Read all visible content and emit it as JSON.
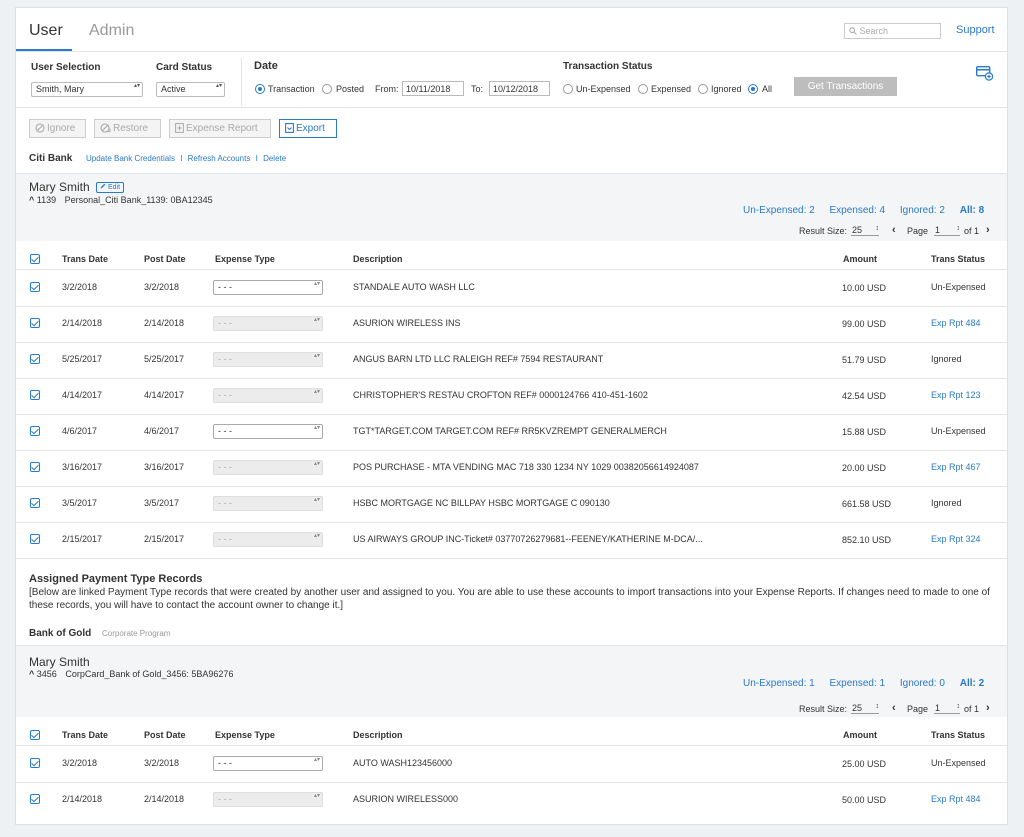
{
  "tabs": {
    "user": "User",
    "admin": "Admin"
  },
  "header": {
    "search_placeholder": "Search",
    "support": "Support"
  },
  "filters": {
    "user_selection_label": "User Selection",
    "user_selection_value": "Smith, Mary",
    "card_status_label": "Card Status",
    "card_status_value": "Active",
    "date_label": "Date",
    "date_options": [
      "Transaction",
      "Posted"
    ],
    "from_label": "From:",
    "from_value": "10/11/2018",
    "to_label": "To:",
    "to_value": "10/12/2018",
    "trans_status_label": "Transaction Status",
    "status_options": [
      "Un-Expensed",
      "Expensed",
      "Ignored",
      "All"
    ],
    "get_button": "Get Transactions"
  },
  "toolbar": {
    "ignore": "Ignore",
    "restore": "Restore",
    "expense_report": "Expense Report",
    "export": "Export"
  },
  "bank1": {
    "name": "Citi Bank",
    "links": [
      "Update Bank Credentials",
      "Refresh Accounts",
      "Delete"
    ],
    "sep": "I"
  },
  "account1": {
    "name": "Mary Smith",
    "edit": "Edit",
    "number": "1139",
    "detail": "Personal_Citi Bank_1139: 0BA12345",
    "counts": {
      "unexpensed": "Un-Expensed: 2",
      "expensed": "Expensed: 4",
      "ignored": "Ignored: 2",
      "all": "All: 8"
    },
    "result_size_label": "Result Size:",
    "result_size": "25",
    "page_label": "Page",
    "page": "1",
    "of": "of 1"
  },
  "columns": {
    "trans_date": "Trans Date",
    "post_date": "Post Date",
    "expense_type": "Expense Type",
    "description": "Description",
    "amount": "Amount",
    "trans_status": "Trans Status"
  },
  "rows1": [
    {
      "trans": "3/2/2018",
      "post": "3/2/2018",
      "etype": "- - -",
      "desc": "STANDALE AUTO WASH LLC",
      "amount": "10.00 USD",
      "status": "Un-Expensed"
    },
    {
      "trans": "2/14/2018",
      "post": "2/14/2018",
      "etype": "- - -",
      "desc": "ASURION WIRELESS INS",
      "amount": "99.00 USD",
      "status": "Exp Rpt 484"
    },
    {
      "trans": "5/25/2017",
      "post": "5/25/2017",
      "etype": "- - -",
      "desc": "ANGUS BARN LTD LLC RALEIGH REF# 7594 RESTAURANT",
      "amount": "51.79 USD",
      "status": "Ignored"
    },
    {
      "trans": "4/14/2017",
      "post": "4/14/2017",
      "etype": "- - -",
      "desc": "CHRISTOPHER'S RESTAU CROFTON REF# 0000124766 410-451-1602",
      "amount": "42.54 USD",
      "status": "Exp Rpt 123"
    },
    {
      "trans": "4/6/2017",
      "post": "4/6/2017",
      "etype": "- - -",
      "desc": "TGT*TARGET.COM TARGET.COM REF# RR5KVZREMPT GENERALMERCH",
      "amount": "15.88 USD",
      "status": "Un-Expensed"
    },
    {
      "trans": "3/16/2017",
      "post": "3/16/2017",
      "etype": "- - -",
      "desc": "POS PURCHASE - MTA VENDING MAC 718 330 1234 NY 1029 00382056614924087",
      "amount": "20.00 USD",
      "status": "Exp Rpt 467"
    },
    {
      "trans": "3/5/2017",
      "post": "3/5/2017",
      "etype": "- - -",
      "desc": "HSBC MORTGAGE NC BILLPAY HSBC MORTGAGE C 090130",
      "amount": "661.58 USD",
      "status": "Ignored"
    },
    {
      "trans": "2/15/2017",
      "post": "2/15/2017",
      "etype": "- - -",
      "desc": "US AIRWAYS GROUP INC-Ticket# 03770726279681--FEENEY/KATHERINE M-DCA/...",
      "amount": "852.10 USD",
      "status": "Exp Rpt 324"
    }
  ],
  "assigned": {
    "title": "Assigned Payment Type Records",
    "text": "[Below are linked Payment Type records that were created by another user and assigned to you. You are able to use these accounts to import transactions into your Expense Reports. If changes need to made to one of these records, you will have to contact the account owner to change it.]"
  },
  "bank2": {
    "name": "Bank of Gold",
    "program": "Corporate Program"
  },
  "account2": {
    "name": "Mary Smith",
    "number": "3456",
    "detail": "CorpCard_Bank of Gold_3456: 5BA96276",
    "counts": {
      "unexpensed": "Un-Expensed: 1",
      "expensed": "Expensed: 1",
      "ignored": "Ignored: 0",
      "all": "All: 2"
    },
    "result_size_label": "Result Size:",
    "result_size": "25",
    "page_label": "Page",
    "page": "1",
    "of": "of 1"
  },
  "rows2": [
    {
      "trans": "3/2/2018",
      "post": "3/2/2018",
      "etype": "- - -",
      "desc": "AUTO WASH123456000",
      "amount": "25.00 USD",
      "status": "Un-Expensed"
    },
    {
      "trans": "2/14/2018",
      "post": "2/14/2018",
      "etype": "- - -",
      "desc": "ASURION WIRELESS000",
      "amount": "50.00 USD",
      "status": "Exp Rpt 484"
    }
  ]
}
